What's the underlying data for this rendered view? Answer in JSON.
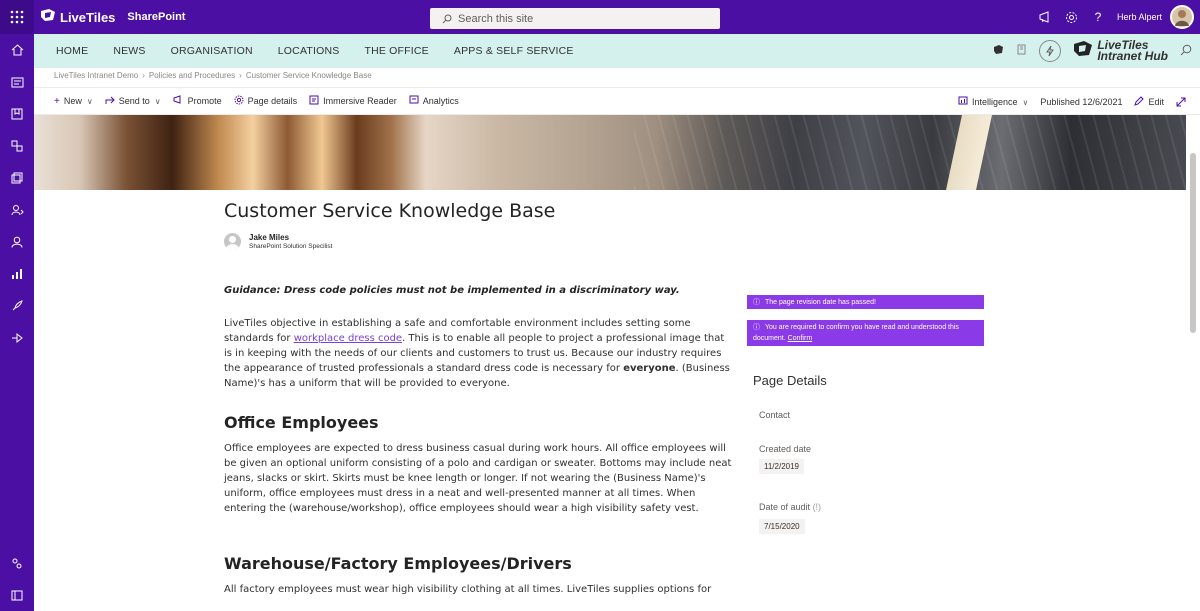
{
  "suitebar": {
    "brand": "LiveTiles",
    "app": "SharePoint",
    "search_placeholder": "Search this site",
    "user_name": "Herb Alpert"
  },
  "hubnav": {
    "links": [
      "HOME",
      "NEWS",
      "ORGANISATION",
      "LOCATIONS",
      "THE OFFICE",
      "APPS & SELF SERVICE"
    ],
    "logo_line1": "LiveTiles",
    "logo_line2": "Intranet Hub"
  },
  "breadcrumb": [
    "LiveTiles Intranet Demo",
    "Policies and Procedures",
    "Customer Service Knowledge Base"
  ],
  "commandbar": {
    "new": "New",
    "send_to": "Send to",
    "promote": "Promote",
    "page_details": "Page details",
    "immersive_reader": "Immersive Reader",
    "analytics": "Analytics",
    "intelligence": "Intelligence",
    "published": "Published 12/6/2021",
    "edit": "Edit"
  },
  "page": {
    "title": "Customer Service Knowledge Base",
    "author_name": "Jake Miles",
    "author_role": "SharePoint Solution Specilist",
    "guidance": "Guidance: Dress code policies must not be implemented in a discriminatory way.",
    "p1_a": "LiveTiles objective in establishing a safe and comfortable environment includes setting some standards for ",
    "p1_link": "workplace dress code",
    "p1_b": ". This is to enable all people to project a professional image that is in keeping with the needs of our clients and customers to trust us. Because our industry requires the appearance of trusted professionals a standard dress code is necessary for ",
    "p1_bold": "everyone",
    "p1_c": ". (Business Name)'s has a uniform that will be provided to everyone.",
    "h_office": "Office Employees",
    "p2": "Office employees are expected to dress business casual during work hours. All office employees will be given an optional uniform consisting of a polo and cardigan or sweater. Bottoms may include neat jeans, slacks or skirt. Skirts must be knee length or longer. If not wearing the (Business Name)'s uniform, office employees must dress in a neat and well-presented manner at all times. When entering the (warehouse/workshop), office employees should wear a high visibility safety vest.",
    "h_warehouse": "Warehouse/Factory Employees/Drivers",
    "p3": "All factory employees must wear high visibility clothing at all times. LiveTiles supplies options for"
  },
  "sidebar": {
    "alert1": "The page revision date has passed!",
    "alert2_text": "You are required to confirm you have read and understood this document. ",
    "alert2_link": "Confirm",
    "details_title": "Page Details",
    "contact_label": "Contact",
    "created_label": "Created date",
    "created_value": "11/2/2019",
    "audit_label": "Date of audit",
    "audit_hint": "(!)",
    "audit_value": "7/15/2020"
  },
  "colors": {
    "suitebar": "#4b0fa3",
    "hubnav": "#d5f1ee",
    "alert": "#8b3ae8",
    "link": "#7a3fd6"
  }
}
